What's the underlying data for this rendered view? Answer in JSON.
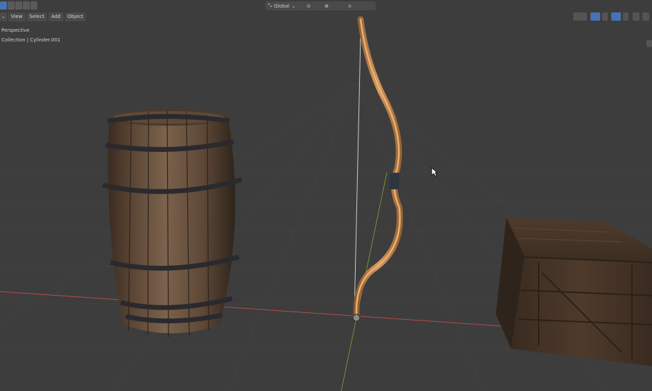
{
  "header": {
    "transform_orientation": "Global",
    "chevron": "⌄"
  },
  "menu": {
    "items": [
      "View",
      "Select",
      "Add",
      "Object"
    ]
  },
  "viewport_info": {
    "view_name": "Perspective",
    "collection_text": "Collection | Cylinder.001"
  },
  "icons": {
    "cursor": "mouse-pointer-icon",
    "selected": "transform-pivot-icon"
  },
  "colors": {
    "background": "#3d3d3d",
    "grid": "#4a4a4a",
    "x_axis": "#b34b4b",
    "y_axis": "#7d9a3a",
    "accent": "#4772b3"
  }
}
